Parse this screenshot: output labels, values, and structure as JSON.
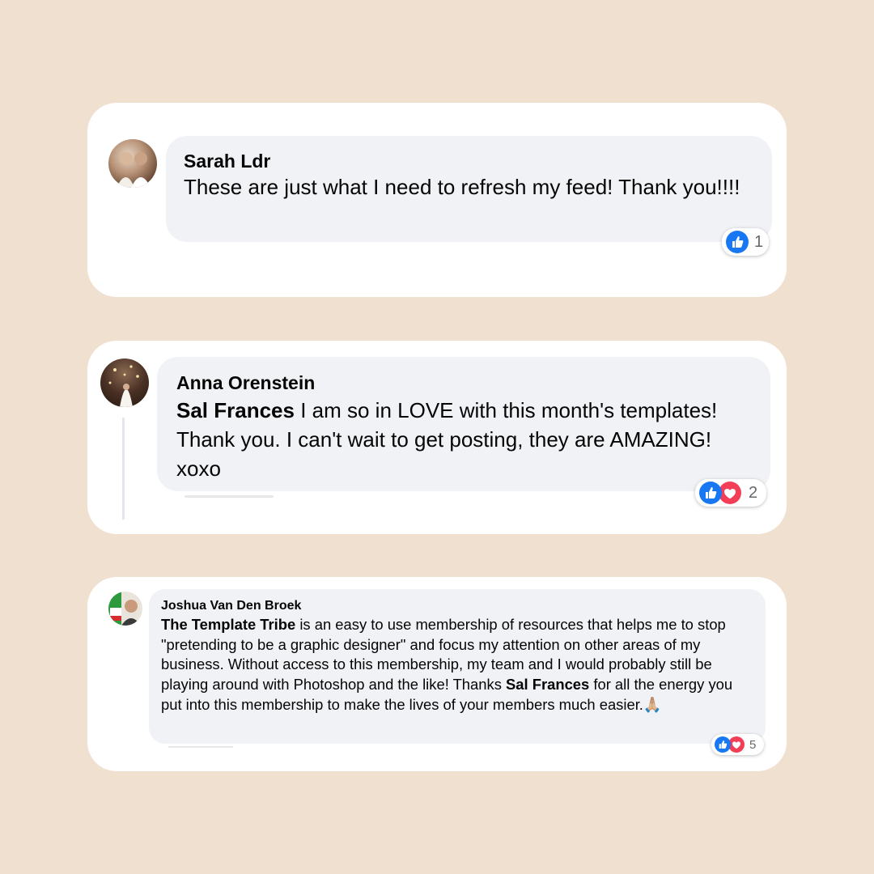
{
  "colors": {
    "page_background": "#f0e0cf",
    "card_background": "#ffffff",
    "bubble_background": "#f0f2f5",
    "like_blue": "#1877f2",
    "love_red": "#f33e58"
  },
  "comments": [
    {
      "author": "Sarah Ldr",
      "text": "These are just what I need to refresh my feed! Thank you!!!!",
      "reactions": {
        "icons": [
          "like-icon"
        ],
        "count": "1"
      }
    },
    {
      "author": "Anna Orenstein",
      "mention": "Sal Frances",
      "text": " I am so in LOVE with this month's templates! Thank you. I can't wait to get posting, they are AMAZING! xoxo",
      "reactions": {
        "icons": [
          "like-icon",
          "love-icon"
        ],
        "count": "2"
      }
    },
    {
      "author": "Joshua Van Den Broek",
      "mention_1": "The Template Tribe",
      "text_1": " is an easy to use membership of resources that helps me to stop \"pretending to be a graphic designer\" and focus my attention on other areas of my business. Without access to this membership, my team and I would probably still be playing around with Photoshop and the like! Thanks ",
      "mention_2": "Sal Frances",
      "text_2": " for all the energy you put into this membership to make the lives of your members much easier.",
      "emoji": "🙏🏼",
      "reactions": {
        "icons": [
          "like-icon",
          "love-icon"
        ],
        "count": "5"
      }
    }
  ]
}
